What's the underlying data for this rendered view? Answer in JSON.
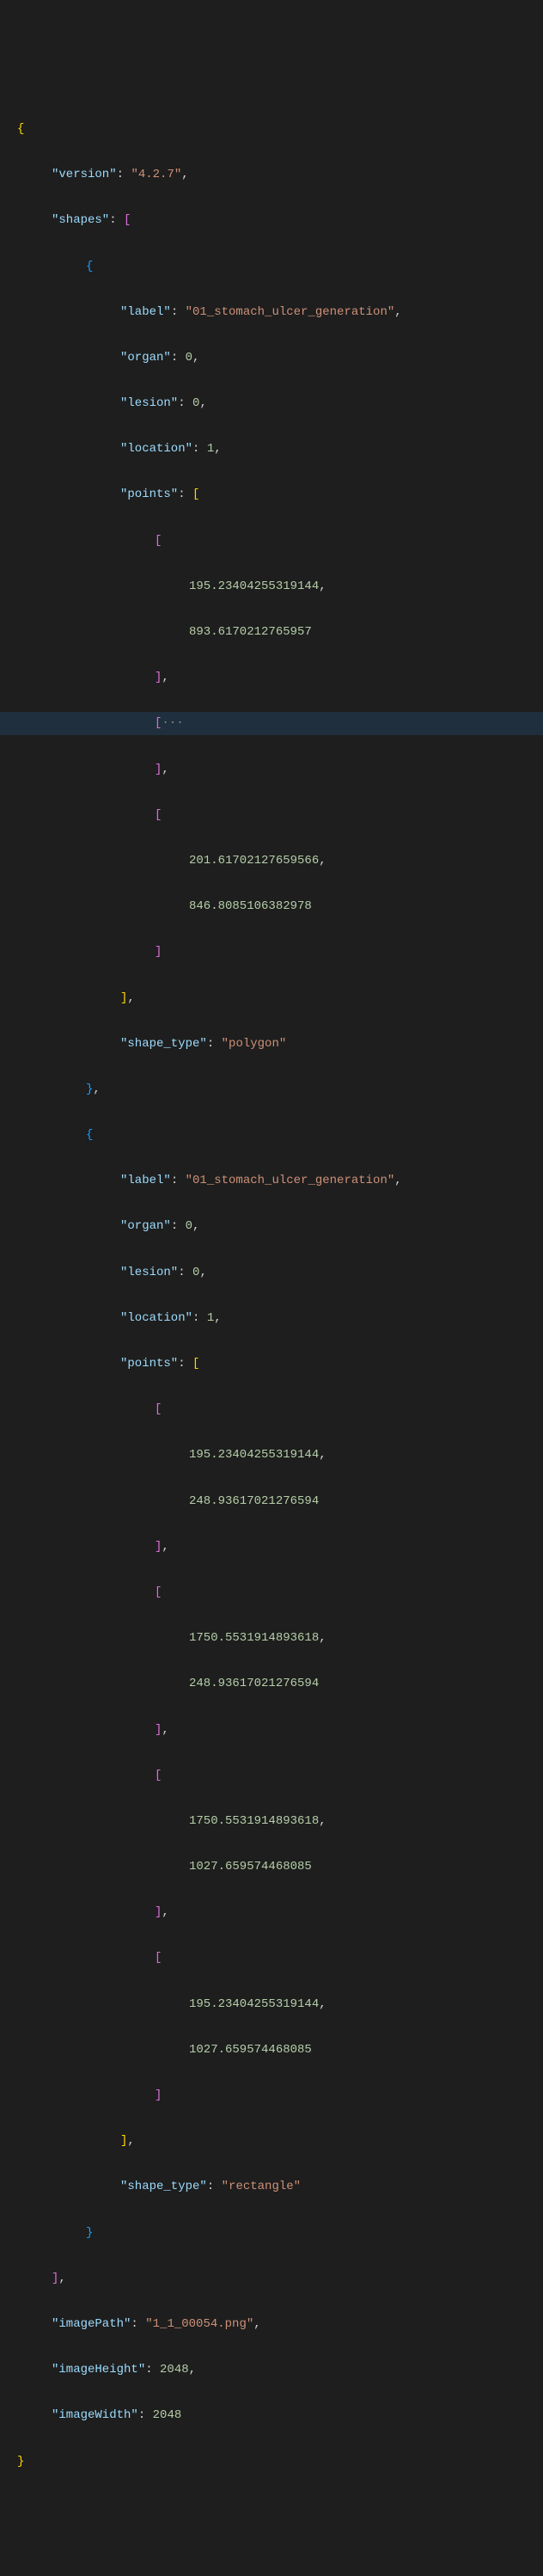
{
  "json": {
    "version_key": "\"version\"",
    "version_val": "\"4.2.7\"",
    "shapes_key": "\"shapes\"",
    "label_key": "\"label\"",
    "label_val": "\"01_stomach_ulcer_generation\"",
    "organ_key": "\"organ\"",
    "organ_val": "0",
    "lesion_key": "\"lesion\"",
    "lesion_val": "0",
    "location_key": "\"location\"",
    "location_val": "1",
    "points_key": "\"points\"",
    "shape_type_key": "\"shape_type\"",
    "polygon_val": "\"polygon\"",
    "rectangle_val": "\"rectangle\"",
    "imagePath_key": "\"imagePath\"",
    "imagePath_val": "\"1_1_00054.png\"",
    "imageHeight_key": "\"imageHeight\"",
    "imageHeight_val": "2048",
    "imageWidth_key": "\"imageWidth\"",
    "imageWidth_val": "2048",
    "p1a": "195.23404255319144",
    "p1b": "893.6170212765957",
    "p2a": "201.61702127659566",
    "p2b": "846.8085106382978",
    "r1a": "195.23404255319144",
    "r1b": "248.93617021276594",
    "r2a": "1750.5531914893618",
    "r2b": "248.93617021276594",
    "r3a": "1750.5531914893618",
    "r3b": "1027.659574468085",
    "r4a": "195.23404255319144",
    "r4b": "1027.659574468085",
    "ellipsis": "···"
  }
}
